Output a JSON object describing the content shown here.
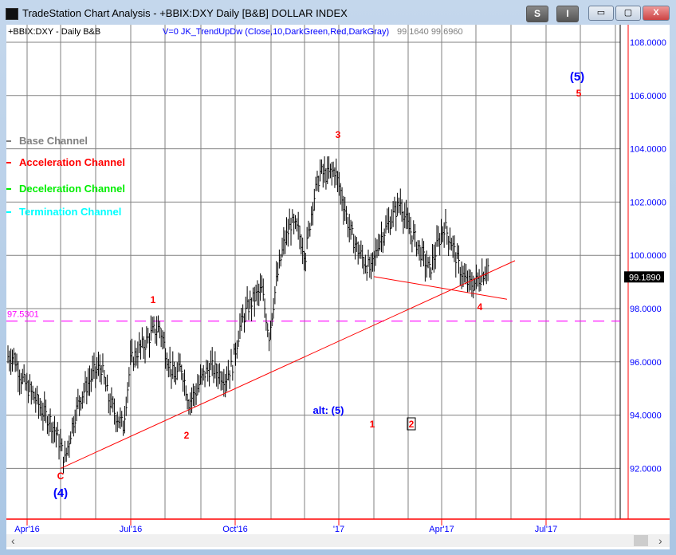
{
  "window": {
    "title": "TradeStation Chart Analysis - +BBIX:DXY Daily [B&B] DOLLAR INDEX",
    "btn_s": "S",
    "btn_i": "I",
    "minimize": "▭",
    "maximize": "▢",
    "close": "X"
  },
  "chart": {
    "symbol_label": "+BBIX:DXY - Daily  B&B",
    "indicator_label": "V=0  JK_TrendUpDw (Close,10,DarkGreen,Red,DarkGray)",
    "indicator_values": "99.1640  99.6960",
    "legend": [
      {
        "label": "Base Channel",
        "color": "#808080"
      },
      {
        "label": "Acceleration Channel",
        "color": "#ff0000"
      },
      {
        "label": "Deceleration Channel",
        "color": "#00ee00"
      },
      {
        "label": "Termination Channel",
        "color": "#00ffff"
      }
    ],
    "last_price": "99.1890",
    "dashed_level": "97.5301",
    "wave_labels": [
      {
        "text": "1",
        "color": "#ff0000",
        "week": 20,
        "price": 98.4
      },
      {
        "text": "2",
        "color": "#ff0000",
        "week": 24,
        "price": 93.3
      },
      {
        "text": "3",
        "color": "#ff0000",
        "week": 43,
        "price": 104.5
      },
      {
        "text": "4",
        "color": "#ff0000",
        "week": 62,
        "price": 98.0
      },
      {
        "text": "5",
        "color": "#ff0000",
        "week": 76,
        "price": 106.0
      },
      {
        "text": "(5)",
        "color": "#0000ff",
        "week": 76,
        "price": 106.6
      },
      {
        "text": "C",
        "color": "#ff0000",
        "week": 7,
        "price": 91.7
      },
      {
        "text": "(4)",
        "color": "#0000ff",
        "week": 7,
        "price": 91.0
      },
      {
        "text": "alt: (5)",
        "color": "#0000ff",
        "week": 42,
        "price": 93.9
      },
      {
        "text": "1",
        "color": "#ff0000",
        "week": 48,
        "price": 93.5
      },
      {
        "text": "2",
        "color": "#ff0000",
        "week": 53,
        "price": 93.5
      }
    ]
  },
  "chart_data": {
    "type": "ohlc",
    "title": "+BBIX:DXY Daily DOLLAR INDEX",
    "ylim": [
      90.2,
      108.8
    ],
    "yticks": [
      "108.0000",
      "106.0000",
      "104.0000",
      "102.0000",
      "100.0000",
      "98.0000",
      "96.0000",
      "94.0000",
      "92.0000"
    ],
    "xticks": [
      "Apr'16",
      "Jul'16",
      "Oct'16",
      "'17",
      "Apr'17",
      "Jul'17"
    ],
    "weekly_closes": [
      96.2,
      95.4,
      95.0,
      94.6,
      94.1,
      93.8,
      93.2,
      92.3,
      93.6,
      94.6,
      95.1,
      95.6,
      95.8,
      94.6,
      94.0,
      93.6,
      96.0,
      96.4,
      96.7,
      97.1,
      97.3,
      96.2,
      95.4,
      95.8,
      94.5,
      94.9,
      95.5,
      95.8,
      95.6,
      95.4,
      95.9,
      97.3,
      98.0,
      98.4,
      98.7,
      97.0,
      99.0,
      100.4,
      101.2,
      100.9,
      100.0,
      102.0,
      103.1,
      103.0,
      103.2,
      102.2,
      101.0,
      100.3,
      99.8,
      99.4,
      100.5,
      101.0,
      101.5,
      102.0,
      101.1,
      100.6,
      100.0,
      99.4,
      100.3,
      101.1,
      100.5,
      99.6,
      99.0,
      98.9,
      99.2,
      99.6
    ]
  },
  "xaxis": {
    "labels": [
      "Apr'16",
      "Jul'16",
      "Oct'16",
      "'17",
      "Apr'17",
      "Jul'17"
    ]
  },
  "scrollbar": {
    "left": "‹",
    "right": "›"
  }
}
